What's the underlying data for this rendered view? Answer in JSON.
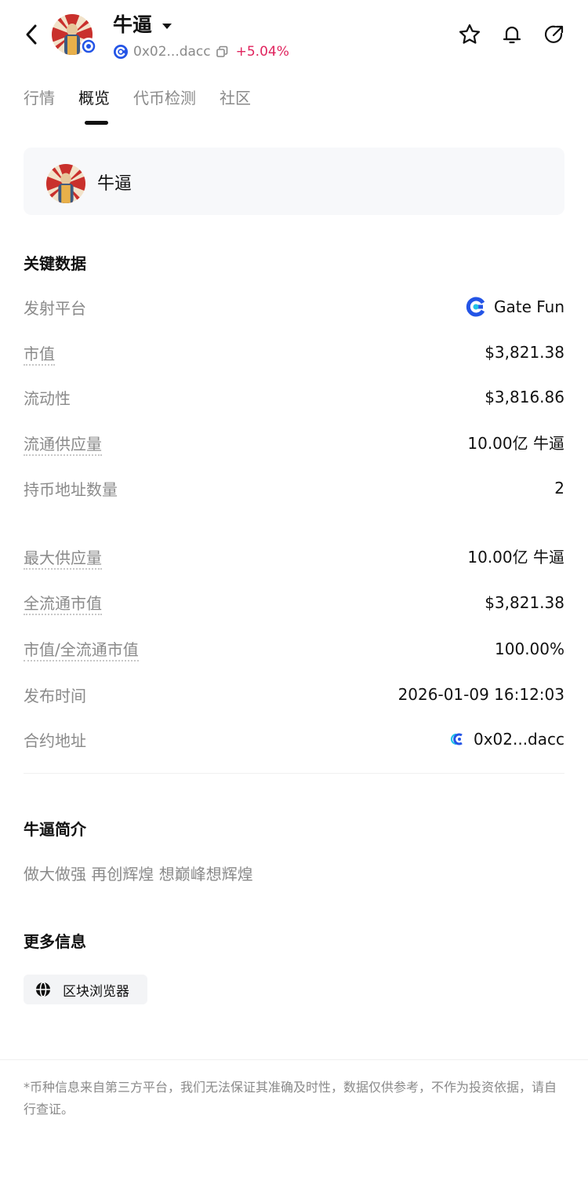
{
  "header": {
    "token_name": "牛逼",
    "address": "0x02...dacc",
    "change": "+5.04%",
    "change_color": "#e0245e",
    "icons": [
      "back-icon",
      "caret-down-icon",
      "chain-icon",
      "copy-icon",
      "star-icon",
      "bell-icon",
      "share-icon"
    ]
  },
  "tabs": [
    {
      "label": "行情",
      "active": false
    },
    {
      "label": "概览",
      "active": true
    },
    {
      "label": "代币检测",
      "active": false
    },
    {
      "label": "社区",
      "active": false
    }
  ],
  "token_card": {
    "name": "牛逼"
  },
  "key_data": {
    "title": "关键数据",
    "rows": [
      {
        "label": "发射平台",
        "value": "Gate Fun"
      },
      {
        "label": "市值",
        "value": "$3,821.38"
      },
      {
        "label": "流动性",
        "value": "$3,816.86"
      },
      {
        "label": "流通供应量",
        "value": "10.00亿 牛逼"
      },
      {
        "label": "持币地址数量",
        "value": "2"
      },
      {
        "label": "最大供应量",
        "value": "10.00亿 牛逼"
      },
      {
        "label": "全流通市值",
        "value": "$3,821.38"
      },
      {
        "label": "市值/全流通市值",
        "value": "100.00%"
      },
      {
        "label": "发布时间",
        "value": "2026-01-09 16:12:03"
      },
      {
        "label": "合约地址",
        "value": "0x02...dacc"
      }
    ]
  },
  "intro": {
    "title": "牛逼简介",
    "text": "做大做强 再创辉煌 想巅峰想辉煌"
  },
  "more_info": {
    "title": "更多信息",
    "explorer_label": "区块浏览器"
  },
  "footer": {
    "note": "*币种信息来自第三方平台，我们无法保证其准确及时性，数据仅供参考，不作为投资依据，请自行查证。"
  },
  "colors": {
    "accent": "#111111",
    "muted": "#8a8a8a",
    "gate_blue": "#2354e6",
    "negative": "#e0245e"
  }
}
